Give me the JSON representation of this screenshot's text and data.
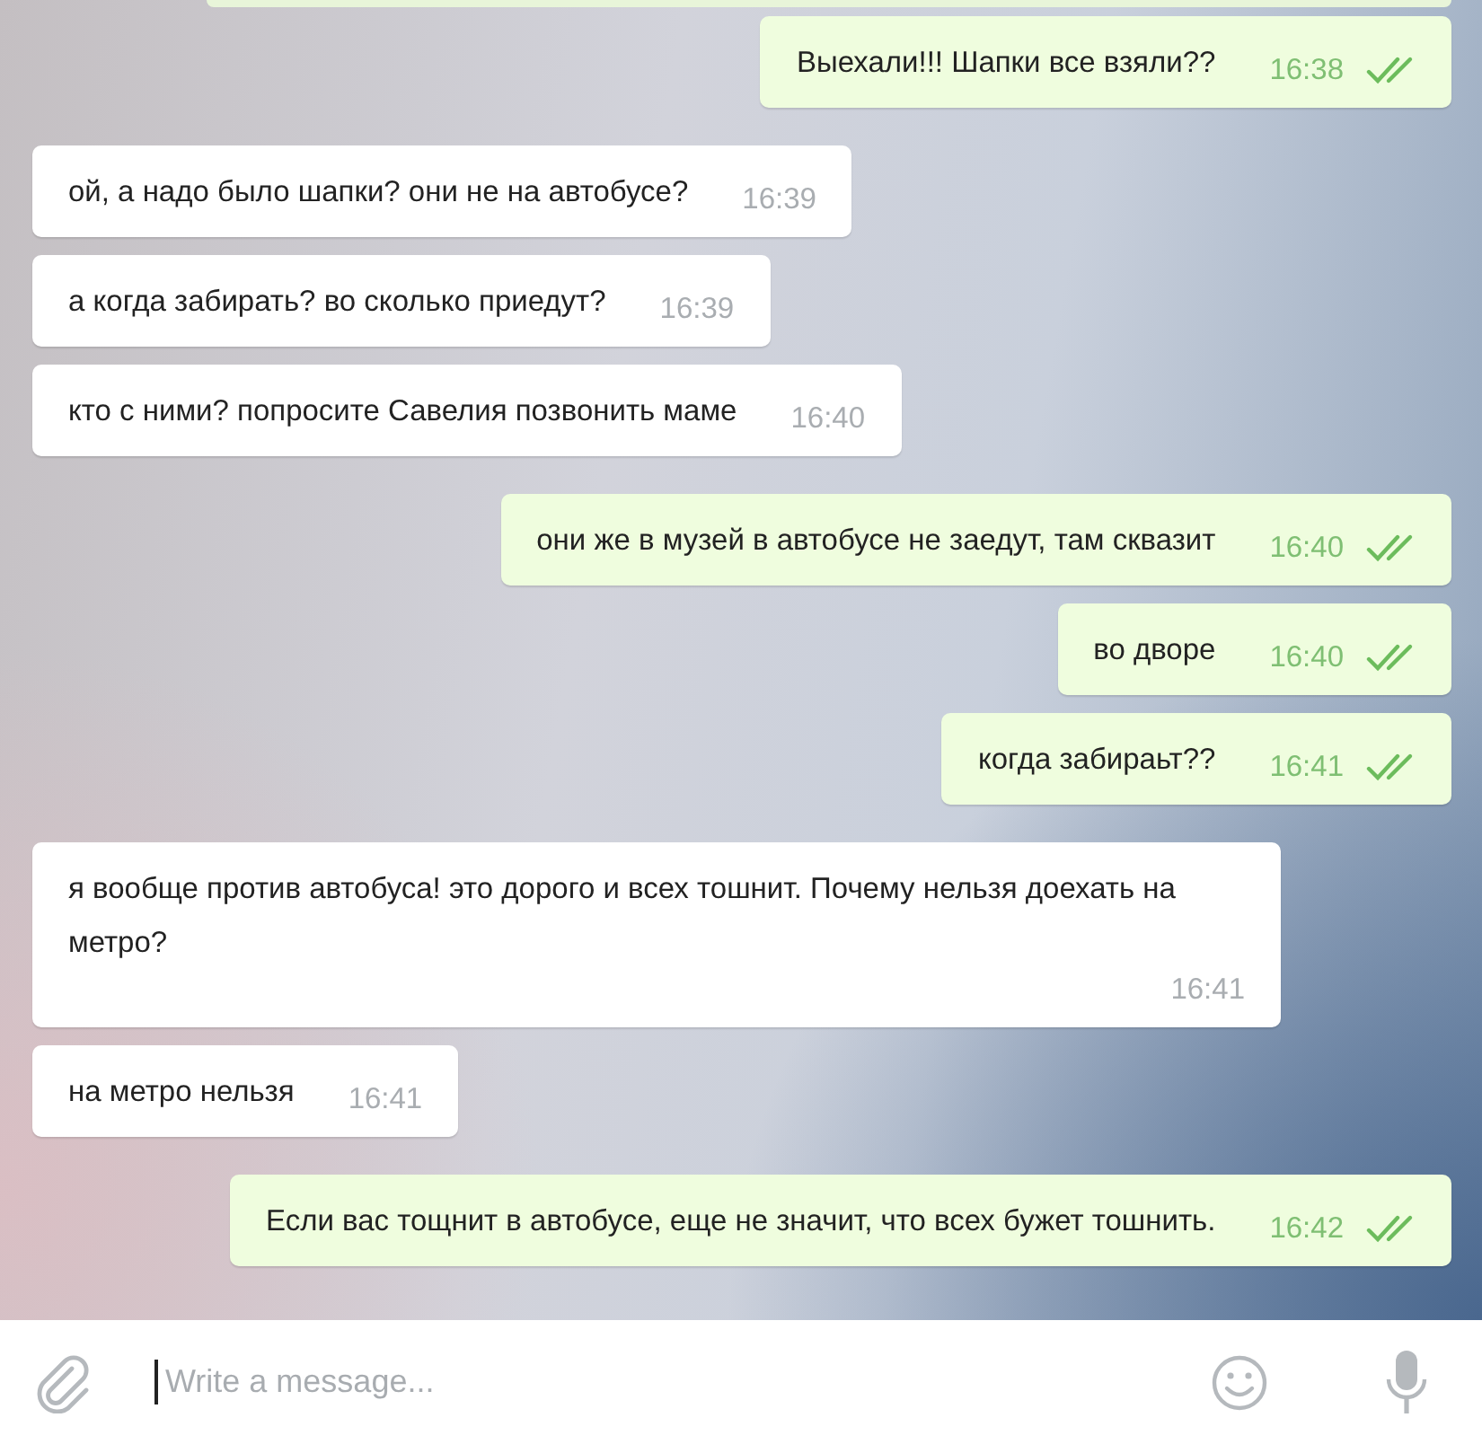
{
  "messages": [
    {
      "kind": "outgoing",
      "text": "Выехали!!! Шапки все взяли??",
      "time": "16:38",
      "read": true
    },
    {
      "kind": "incoming",
      "text": "ой, а надо было шапки? они не на автобусе?",
      "time": "16:39"
    },
    {
      "kind": "incoming",
      "text": "а когда забирать? во сколько приедут?",
      "time": "16:39"
    },
    {
      "kind": "incoming",
      "text": "кто с ними? попросите Савелия позвонить маме",
      "time": "16:40"
    },
    {
      "kind": "outgoing",
      "text": "они же в музей в автобусе не заедут, там сквазит",
      "time": "16:40",
      "read": true
    },
    {
      "kind": "outgoing",
      "text": "во дворе",
      "time": "16:40",
      "read": true
    },
    {
      "kind": "outgoing",
      "text": "когда забираьт??",
      "time": "16:41",
      "read": true
    },
    {
      "kind": "incoming",
      "text": "я вообще против автобуса! это дорого и всех тошнит. Почему нельзя доехать на метро?",
      "time": "16:41"
    },
    {
      "kind": "incoming",
      "text": "на метро нельзя",
      "time": "16:41"
    },
    {
      "kind": "outgoing",
      "text": "Если вас тощнит в автобусе, еще не значит, что всех бужет тошнить.",
      "time": "16:42",
      "read": true
    }
  ],
  "composer": {
    "placeholder": "Write a message..."
  }
}
